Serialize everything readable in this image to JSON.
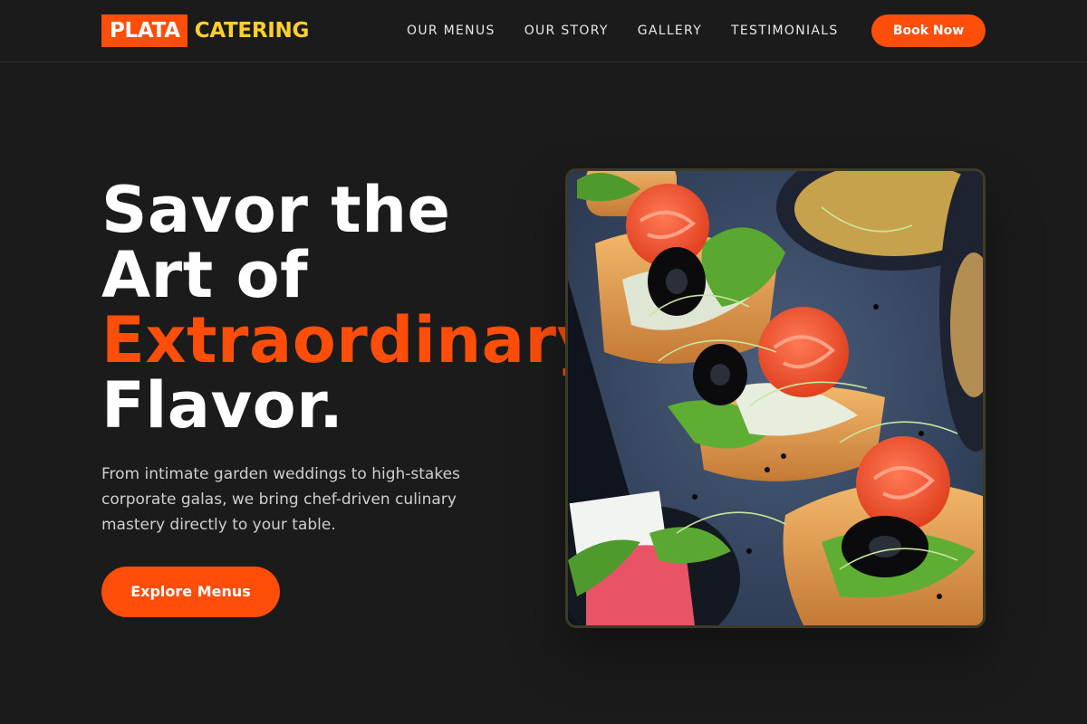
{
  "brand": {
    "badge": "PLATA",
    "name": "CATERING"
  },
  "nav": [
    "OUR MENUS",
    "OUR STORY",
    "GALLERY",
    "TESTIMONIALS"
  ],
  "header": {
    "cta_label": "Book Now"
  },
  "hero": {
    "title_line1": "Savor the",
    "title_line2": "Art of",
    "title_accent": "Extraordinary",
    "title_line4": "Flavor.",
    "description": "From intimate garden weddings to high-stakes corporate galas, we bring chef-driven culinary mastery directly to your table.",
    "cta_label": "Explore Menus",
    "image_subject": "salmon-canape-platter-photo"
  },
  "colors": {
    "accent": "#ff4d0a",
    "logo_text": "#ffcf2e",
    "background": "#1b1b1c"
  }
}
